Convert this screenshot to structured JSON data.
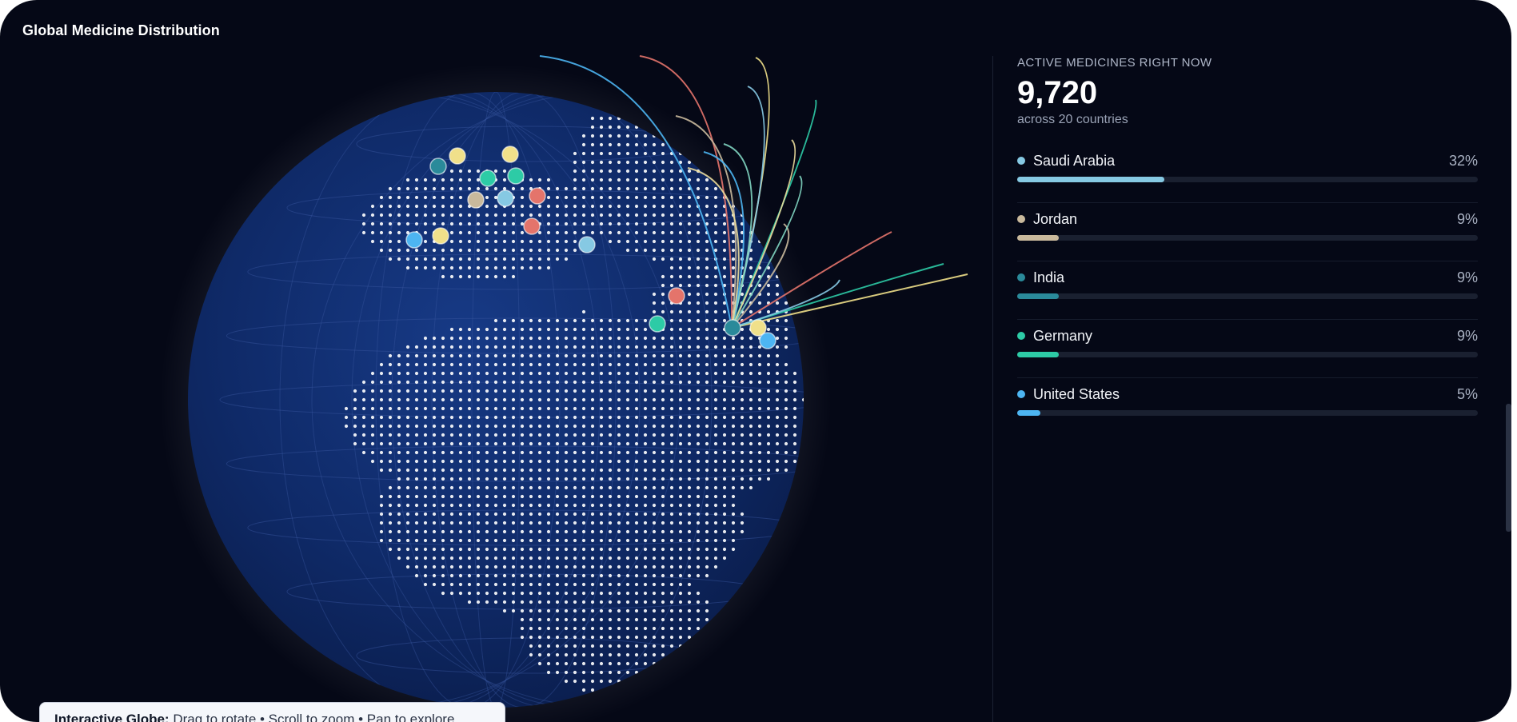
{
  "header": {
    "title": "Global Medicine Distribution"
  },
  "globe": {
    "hint_strong": "Interactive Globe:",
    "hint_text": " Drag to rotate • Scroll to zoom • Pan to explore",
    "ocean_color": "#0c2158",
    "land_dot_color": "#ffffff"
  },
  "stats": {
    "label": "ACTIVE MEDICINES RIGHT NOW",
    "total": "9,720",
    "subtitle": "across 20 countries"
  },
  "countries": [
    {
      "name": "Saudi Arabia",
      "percent_label": "32%",
      "share": 0.32,
      "color": "#86c9e3"
    },
    {
      "name": "Jordan",
      "percent_label": "9%",
      "share": 0.09,
      "color": "#c9b99c"
    },
    {
      "name": "India",
      "percent_label": "9%",
      "share": 0.09,
      "color": "#2a8a9a"
    },
    {
      "name": "Germany",
      "percent_label": "9%",
      "share": 0.09,
      "color": "#2dcba6"
    },
    {
      "name": "United States",
      "percent_label": "5%",
      "share": 0.05,
      "color": "#4db5f2"
    }
  ]
}
